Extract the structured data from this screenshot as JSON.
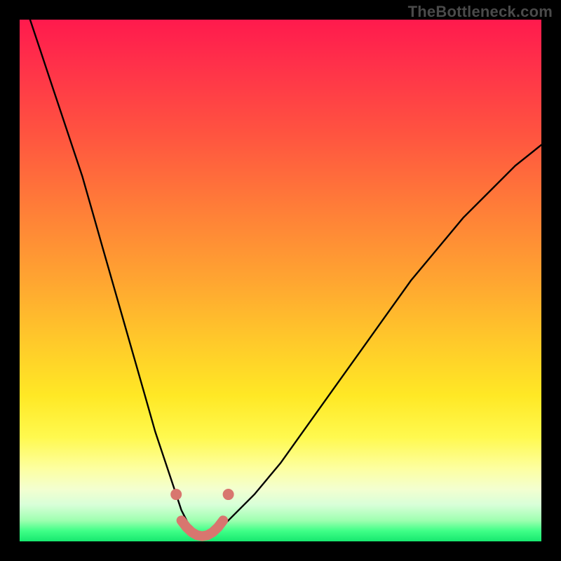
{
  "watermark": "TheBottleneck.com",
  "chart_data": {
    "type": "line",
    "title": "",
    "xlabel": "",
    "ylabel": "",
    "xlim": [
      0,
      100
    ],
    "ylim": [
      0,
      100
    ],
    "series": [
      {
        "name": "bottleneck-curve",
        "x": [
          2,
          4,
          6,
          8,
          10,
          12,
          14,
          16,
          18,
          20,
          22,
          24,
          26,
          28,
          30,
          31,
          32,
          33,
          34,
          35,
          36,
          37,
          38,
          40,
          45,
          50,
          55,
          60,
          65,
          70,
          75,
          80,
          85,
          90,
          95,
          100
        ],
        "y": [
          100,
          94,
          88,
          82,
          76,
          70,
          63,
          56,
          49,
          42,
          35,
          28,
          21,
          15,
          9,
          6,
          4,
          2,
          1,
          0.5,
          0.5,
          1,
          2,
          4,
          9,
          15,
          22,
          29,
          36,
          43,
          50,
          56,
          62,
          67,
          72,
          76
        ]
      }
    ],
    "markers": [
      {
        "name": "left-dot",
        "x": 30,
        "y": 9
      },
      {
        "name": "right-dot",
        "x": 40,
        "y": 9
      }
    ],
    "bottom_segment": {
      "x_start": 31,
      "x_end": 39,
      "y": 1
    },
    "colors": {
      "curve": "#000000",
      "marker": "#d8766f",
      "segment": "#d8766f"
    }
  }
}
